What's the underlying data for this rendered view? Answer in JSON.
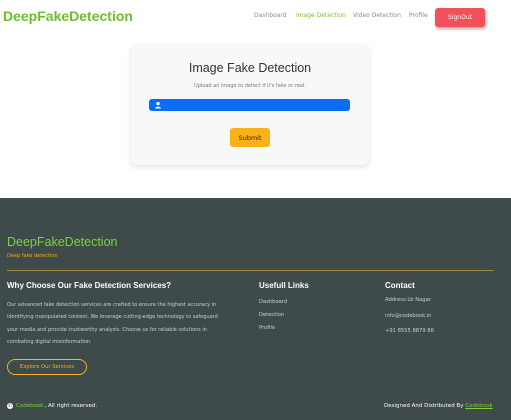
{
  "header": {
    "brand": "DeepFakeDetection",
    "nav": [
      {
        "label": "Dashboard"
      },
      {
        "label": "Image Detection"
      },
      {
        "label": "Video Detection"
      },
      {
        "label": "Profile"
      }
    ],
    "signout_label": "SignOut"
  },
  "card": {
    "title": "Image Fake Detection",
    "subtitle": "Upload an image to detect if it's fake or real.",
    "submit_label": "Submit"
  },
  "footer": {
    "brand": "DeepFakeDetection",
    "tagline": "Deep fake detection",
    "why": {
      "title": "Why Choose Our Fake Detection Services?",
      "lines": [
        "Our advanced fake detection services are crafted to ensure the highest accuracy in",
        "identifying manipulated content. We leverage cutting-edge technology to safeguard",
        "your media and provide trustworthy analysis. Choose us for reliable solutions in",
        "combating digital misinformation."
      ],
      "button_label": "Explore Our Services"
    },
    "links": {
      "title": "Usefull Links",
      "items": [
        "Dashboard",
        "Detection",
        "Profile"
      ]
    },
    "contact": {
      "title": "Contact",
      "items": [
        "Address:Lb Nagar",
        "info@codebook.in",
        "+91 8555 8879 86"
      ]
    },
    "copyright": {
      "icon": "©",
      "brand": "Codebook",
      "text": ", All right reserved."
    },
    "designed": {
      "text": "Designed And Distributed By ",
      "brand": "Codebook"
    }
  },
  "colors": {
    "brand_green": "#6cbf2a",
    "signout_red": "#f0515a",
    "upload_blue": "#0b6cf5",
    "submit_yellow": "#f9b117",
    "footer_bg": "#3e4b4a",
    "accent_orange": "#f2b31c"
  },
  "icons": {
    "upload": "user-upload-icon",
    "copyright": "copyright-icon"
  }
}
